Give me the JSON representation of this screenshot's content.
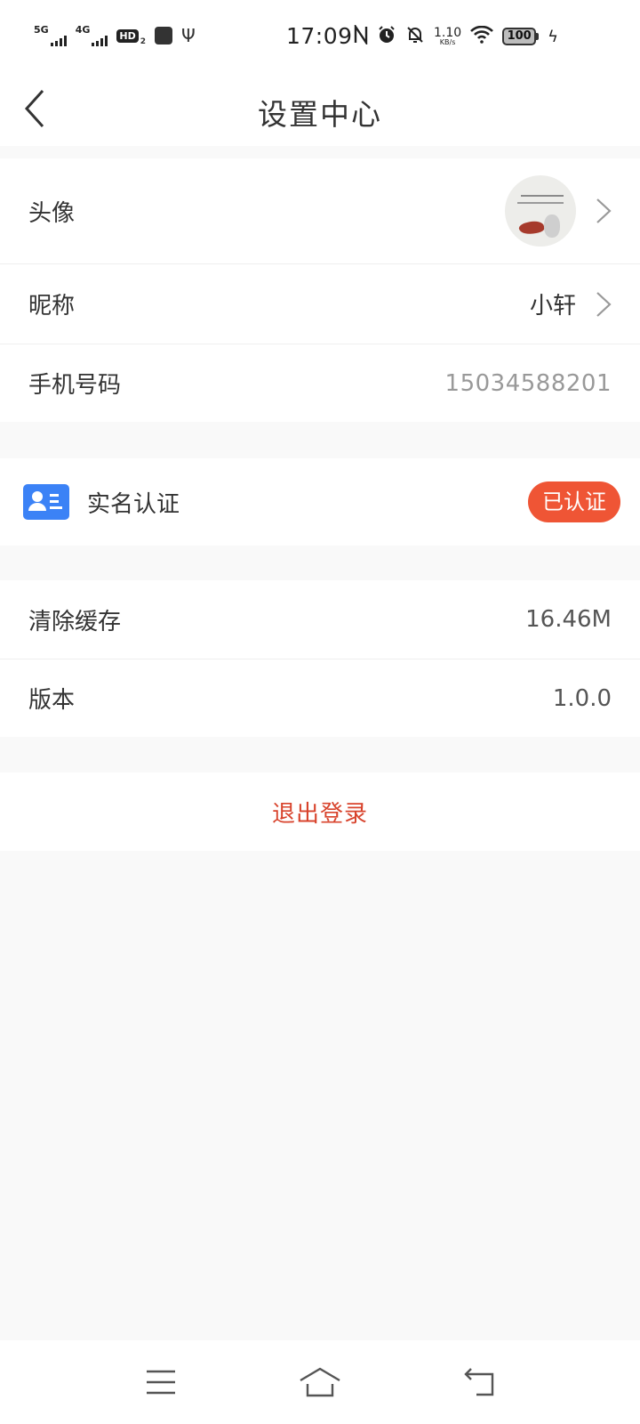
{
  "status_bar": {
    "network1": "5G",
    "network2": "4G",
    "hd_label": "HD",
    "hd_sub": "2",
    "time": "17:09",
    "speed_value": "1.10",
    "speed_unit": "KB/s",
    "battery": "100"
  },
  "header": {
    "title": "设置中心"
  },
  "profile": {
    "avatar_label": "头像",
    "nickname_label": "昵称",
    "nickname_value": "小轩",
    "phone_label": "手机号码",
    "phone_value": "15034588201"
  },
  "verification": {
    "label": "实名认证",
    "status": "已认证",
    "status_color": "#ef5535",
    "icon_color": "#3b82f6"
  },
  "app": {
    "cache_label": "清除缓存",
    "cache_value": "16.46M",
    "version_label": "版本",
    "version_value": "1.0.0"
  },
  "logout": {
    "label": "退出登录",
    "color": "#d8432c"
  },
  "icons": {
    "back": "chevron-left-icon",
    "row_arrow": "chevron-right-icon",
    "nav_menu": "menu-icon",
    "nav_home": "home-icon",
    "nav_back": "return-icon"
  }
}
